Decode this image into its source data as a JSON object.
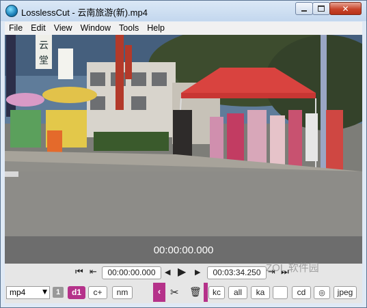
{
  "window": {
    "title": "LosslessCut - 云南旅游(新).mp4",
    "close_glyph": "✕"
  },
  "menu": [
    "File",
    "Edit",
    "View",
    "Window",
    "Tools",
    "Help"
  ],
  "video": {
    "sign_words": [
      "云",
      "堂"
    ]
  },
  "timeline": {
    "current_time": "00:00:00.000"
  },
  "controls": {
    "cut_start_time": "00:00:00.000",
    "cut_end_time": "00:03:34.250",
    "format": "mp4",
    "badge": "1",
    "buttons": {
      "d1": "d1",
      "c_plus": "c+",
      "nm": "nm",
      "kc": "kc",
      "all": "all",
      "ka": "ka",
      "cd": "cd",
      "jpeg": "jpeg"
    },
    "icons": {
      "skip_start": "skip-to-start-icon",
      "set_start": "set-cut-start-icon",
      "prev_frame": "prev-frame-icon",
      "play": "play-icon",
      "next_frame": "next-frame-icon",
      "set_end": "set-cut-end-icon",
      "skip_end": "skip-to-end-icon",
      "scissors": "scissors-icon",
      "trash": "trash-icon",
      "camera": "camera-icon"
    }
  },
  "watermark": "ZOL 软件园"
}
